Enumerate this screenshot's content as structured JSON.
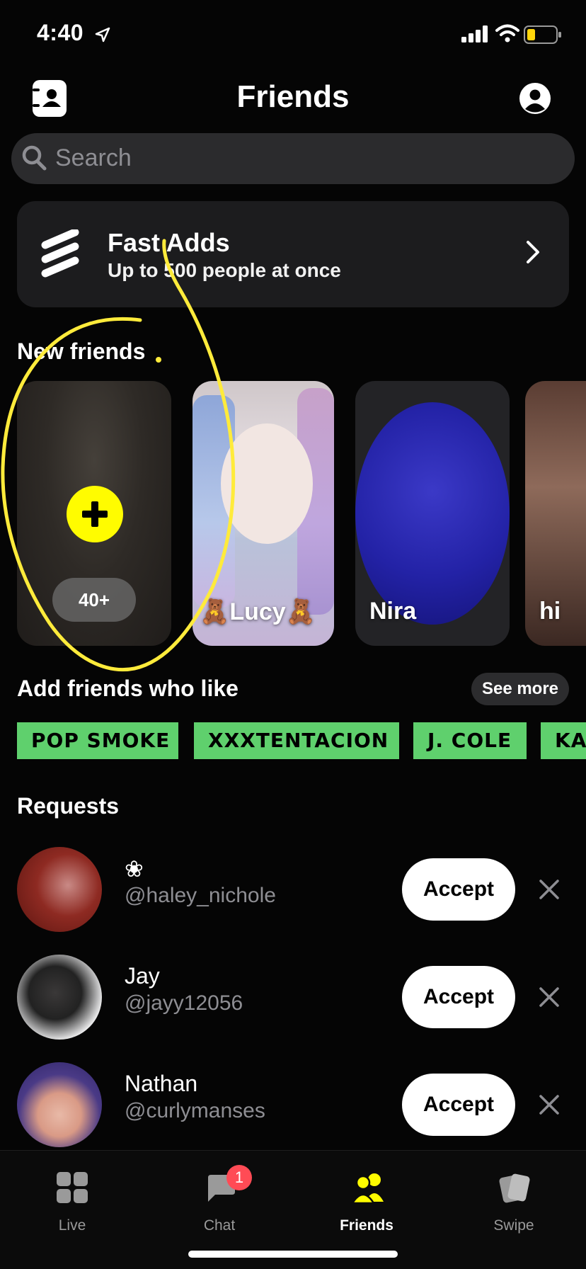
{
  "status_bar": {
    "time": "4:40"
  },
  "header": {
    "title": "Friends"
  },
  "search": {
    "placeholder": "Search"
  },
  "fast_adds": {
    "title": "Fast Adds",
    "subtitle": "Up to 500 people at once"
  },
  "new_friends": {
    "title": "New friends",
    "more_count": "40+",
    "cards": [
      {
        "name": "🧸Lucy🧸"
      },
      {
        "name": "Nira"
      },
      {
        "name": "hi"
      }
    ]
  },
  "interests": {
    "title": "Add friends who like",
    "see_more": "See more",
    "tags": [
      "POP SMOKE",
      "XXXTENTACION",
      "J. COLE",
      "KA"
    ]
  },
  "requests": {
    "title": "Requests",
    "items": [
      {
        "name": "❀",
        "handle": "@haley_nichole",
        "accept": "Accept"
      },
      {
        "name": "Jay",
        "handle": "@jayy12056",
        "accept": "Accept"
      },
      {
        "name": "Nathan",
        "handle": "@curlymanses",
        "accept": "Accept"
      }
    ]
  },
  "tab_bar": {
    "tabs": [
      {
        "label": "Live"
      },
      {
        "label": "Chat",
        "badge": "1"
      },
      {
        "label": "Friends"
      },
      {
        "label": "Swipe"
      }
    ]
  },
  "colors": {
    "accent_yellow": "#fffc00",
    "tag_green": "#5fd06d",
    "badge_red": "#ff4b55"
  }
}
